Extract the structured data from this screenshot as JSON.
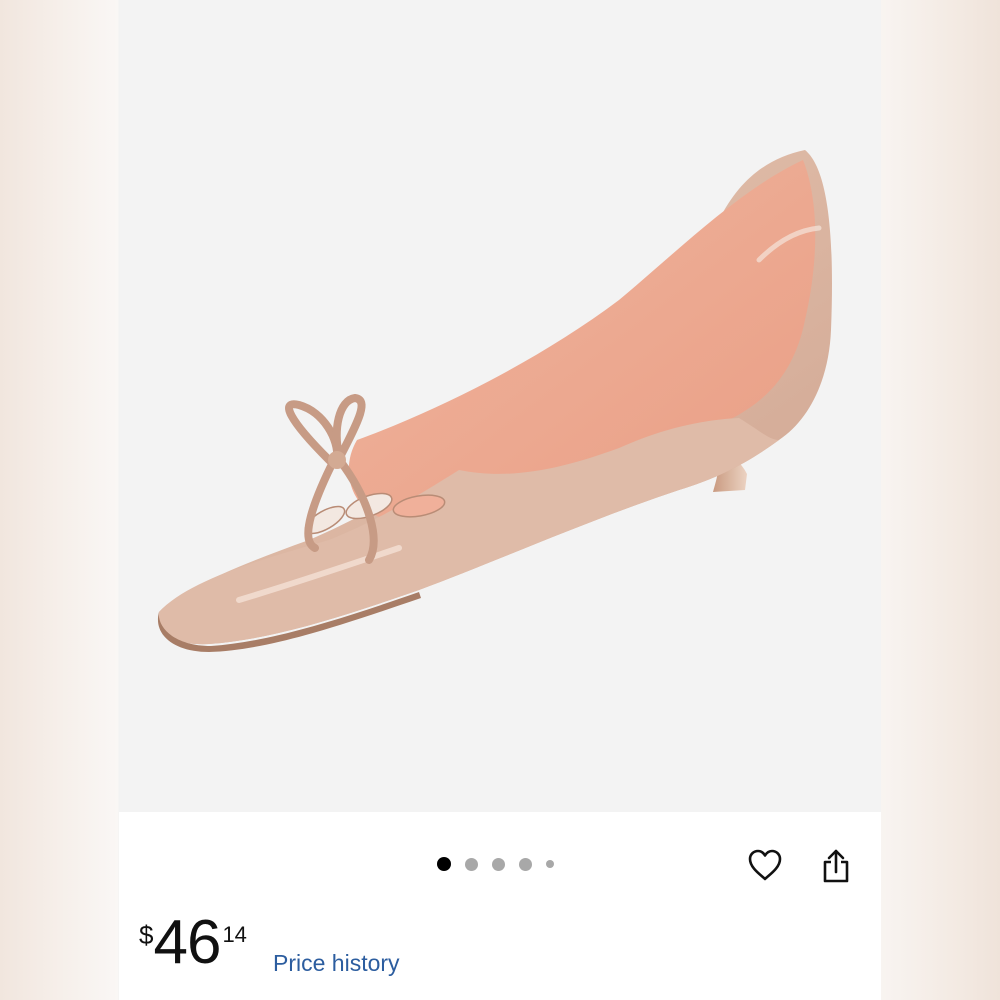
{
  "carousel": {
    "slide_count": 5,
    "active_index": 0
  },
  "actions": {
    "favorite_icon": "heart-outline-icon",
    "share_icon": "share-icon"
  },
  "price": {
    "currency": "$",
    "whole": "46",
    "cents": "14"
  },
  "links": {
    "price_history": "Price history"
  },
  "colors": {
    "link": "#2c5d9f",
    "active_dot": "#000000",
    "inactive_dot": "#a8a8a8"
  }
}
